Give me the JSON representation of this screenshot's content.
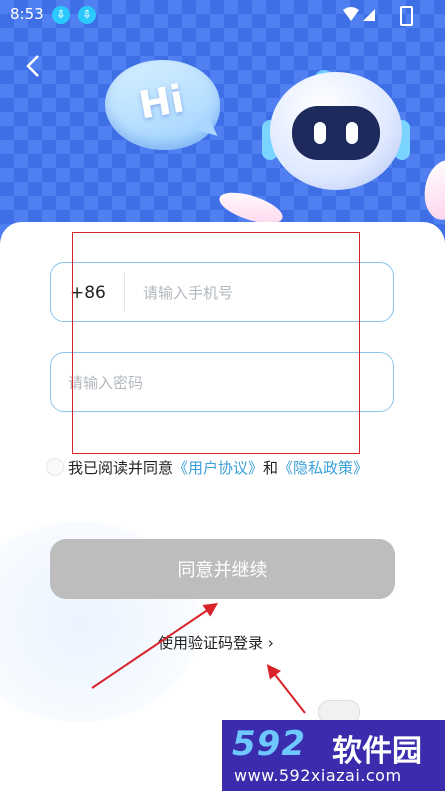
{
  "status_bar": {
    "time": "8:53",
    "download_badge": "⇩"
  },
  "hero": {
    "bubble_text": "Hi"
  },
  "login": {
    "country_code": "+86",
    "phone_placeholder": "请输入手机号",
    "password_placeholder": "请输入密码",
    "agree_prefix": "我已阅读并同意",
    "user_agreement": "《用户协议》",
    "and_word": "和",
    "privacy_policy": "《隐私政策》",
    "continue_button": "同意并继续",
    "alt_login": "使用验证码登录 ›"
  },
  "watermark": {
    "number": "592",
    "name": "软件园",
    "url": "www.592xiazai.com"
  },
  "colors": {
    "accent": "#3aa0d8",
    "field_border": "#8cc6ea",
    "button_disabled": "#bdbdbd",
    "annotation": "#d8232a"
  }
}
